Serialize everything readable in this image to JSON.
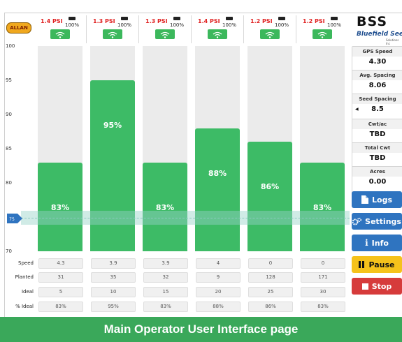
{
  "logo_text": "ALLAN",
  "brand": {
    "name": "BSS",
    "subtitle": "Bluefield Seeding",
    "tagline": "Solutions Inc"
  },
  "y_axis_ticks": [
    "100",
    "95",
    "90",
    "85",
    "80",
    "75",
    "70"
  ],
  "current_marker": "75",
  "colors": {
    "bar": "#3dbb66",
    "psi": "#e02020",
    "blue": "#2f74c0",
    "yellow": "#f5c21b",
    "red": "#d63b3b",
    "caption": "#3aa85a"
  },
  "columns": [
    {
      "psi": "1.4 PSI",
      "battery": "100%",
      "percent_label": "83%",
      "percent": 83,
      "speed": "4.3",
      "planted": "31",
      "ideal": "5",
      "pct_ideal": "83%"
    },
    {
      "psi": "1.3 PSI",
      "battery": "100%",
      "percent_label": "95%",
      "percent": 95,
      "speed": "3.9",
      "planted": "35",
      "ideal": "10",
      "pct_ideal": "95%"
    },
    {
      "psi": "1.3 PSI",
      "battery": "100%",
      "percent_label": "83%",
      "percent": 83,
      "speed": "3.9",
      "planted": "32",
      "ideal": "15",
      "pct_ideal": "83%"
    },
    {
      "psi": "1.4 PSI",
      "battery": "100%",
      "percent_label": "88%",
      "percent": 88,
      "speed": "4",
      "planted": "9",
      "ideal": "20",
      "pct_ideal": "88%"
    },
    {
      "psi": "1.2 PSI",
      "battery": "100%",
      "percent_label": "86%",
      "percent": 86,
      "speed": "0",
      "planted": "128",
      "ideal": "25",
      "pct_ideal": "86%"
    },
    {
      "psi": "1.2 PSI",
      "battery": "100%",
      "percent_label": "83%",
      "percent": 83,
      "speed": "0",
      "planted": "171",
      "ideal": "30",
      "pct_ideal": "83%"
    }
  ],
  "row_labels": {
    "speed": "Speed",
    "planted": "Planted",
    "ideal": "Ideal",
    "pct_ideal": "% Ideal"
  },
  "stats": {
    "gps_speed": {
      "label": "GPS Speed",
      "value": "4.30"
    },
    "avg_spacing": {
      "label": "Avg. Spacing",
      "value": "8.06"
    },
    "seed_spacing": {
      "label": "Seed Spacing",
      "value": "8.5"
    },
    "cwt_ac": {
      "label": "Cwt/ac",
      "value": "TBD"
    },
    "total_cwt": {
      "label": "Total Cwt",
      "value": "TBD"
    },
    "acres": {
      "label": "Acres",
      "value": "0.00"
    }
  },
  "buttons": {
    "logs": "Logs",
    "settings": "Settings",
    "info": "Info",
    "pause": "Pause",
    "stop": "Stop"
  },
  "caption": "Main Operator User Interface page"
}
